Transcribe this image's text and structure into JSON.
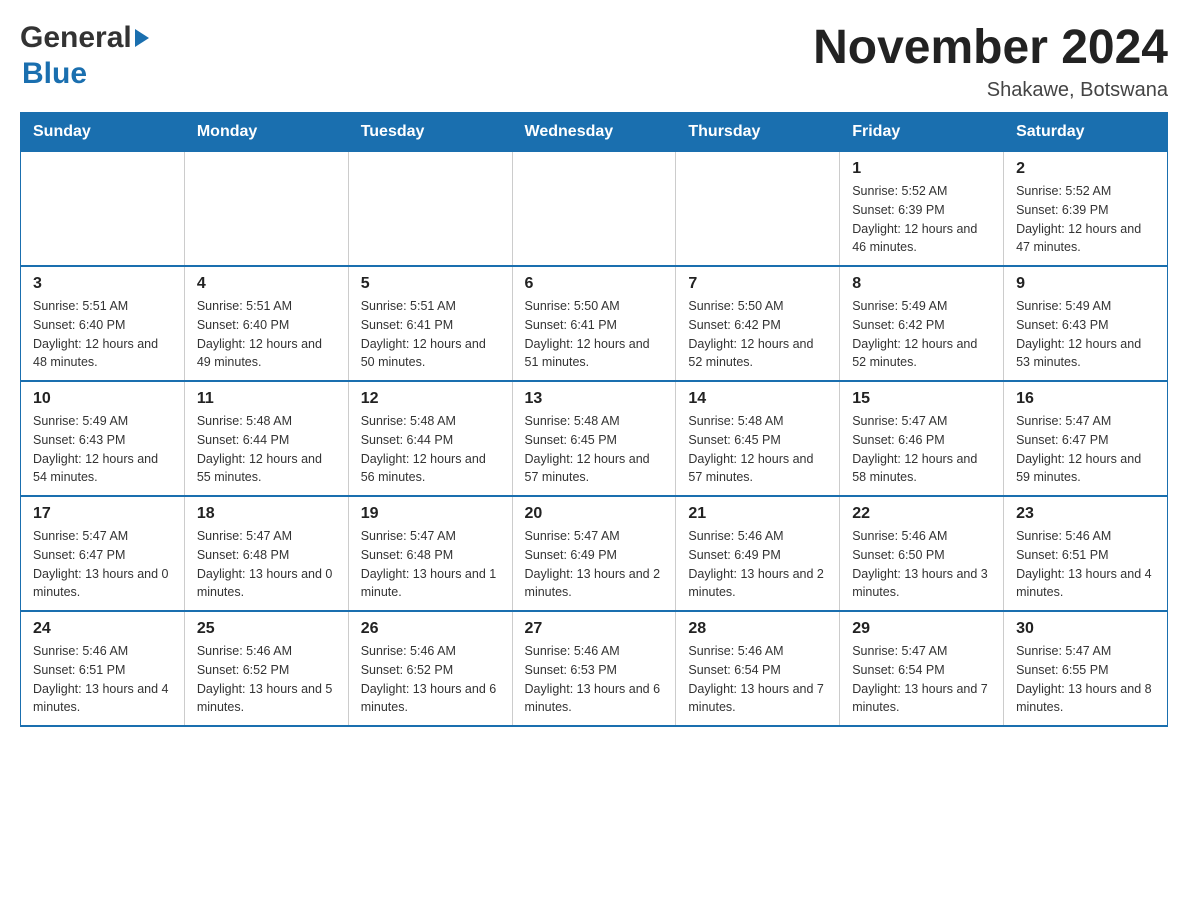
{
  "logo": {
    "general": "General",
    "blue": "Blue",
    "arrow": "▶"
  },
  "title": "November 2024",
  "subtitle": "Shakawe, Botswana",
  "days_header": [
    "Sunday",
    "Monday",
    "Tuesday",
    "Wednesday",
    "Thursday",
    "Friday",
    "Saturday"
  ],
  "weeks": [
    [
      {
        "day": "",
        "info": ""
      },
      {
        "day": "",
        "info": ""
      },
      {
        "day": "",
        "info": ""
      },
      {
        "day": "",
        "info": ""
      },
      {
        "day": "",
        "info": ""
      },
      {
        "day": "1",
        "info": "Sunrise: 5:52 AM\nSunset: 6:39 PM\nDaylight: 12 hours and 46 minutes."
      },
      {
        "day": "2",
        "info": "Sunrise: 5:52 AM\nSunset: 6:39 PM\nDaylight: 12 hours and 47 minutes."
      }
    ],
    [
      {
        "day": "3",
        "info": "Sunrise: 5:51 AM\nSunset: 6:40 PM\nDaylight: 12 hours and 48 minutes."
      },
      {
        "day": "4",
        "info": "Sunrise: 5:51 AM\nSunset: 6:40 PM\nDaylight: 12 hours and 49 minutes."
      },
      {
        "day": "5",
        "info": "Sunrise: 5:51 AM\nSunset: 6:41 PM\nDaylight: 12 hours and 50 minutes."
      },
      {
        "day": "6",
        "info": "Sunrise: 5:50 AM\nSunset: 6:41 PM\nDaylight: 12 hours and 51 minutes."
      },
      {
        "day": "7",
        "info": "Sunrise: 5:50 AM\nSunset: 6:42 PM\nDaylight: 12 hours and 52 minutes."
      },
      {
        "day": "8",
        "info": "Sunrise: 5:49 AM\nSunset: 6:42 PM\nDaylight: 12 hours and 52 minutes."
      },
      {
        "day": "9",
        "info": "Sunrise: 5:49 AM\nSunset: 6:43 PM\nDaylight: 12 hours and 53 minutes."
      }
    ],
    [
      {
        "day": "10",
        "info": "Sunrise: 5:49 AM\nSunset: 6:43 PM\nDaylight: 12 hours and 54 minutes."
      },
      {
        "day": "11",
        "info": "Sunrise: 5:48 AM\nSunset: 6:44 PM\nDaylight: 12 hours and 55 minutes."
      },
      {
        "day": "12",
        "info": "Sunrise: 5:48 AM\nSunset: 6:44 PM\nDaylight: 12 hours and 56 minutes."
      },
      {
        "day": "13",
        "info": "Sunrise: 5:48 AM\nSunset: 6:45 PM\nDaylight: 12 hours and 57 minutes."
      },
      {
        "day": "14",
        "info": "Sunrise: 5:48 AM\nSunset: 6:45 PM\nDaylight: 12 hours and 57 minutes."
      },
      {
        "day": "15",
        "info": "Sunrise: 5:47 AM\nSunset: 6:46 PM\nDaylight: 12 hours and 58 minutes."
      },
      {
        "day": "16",
        "info": "Sunrise: 5:47 AM\nSunset: 6:47 PM\nDaylight: 12 hours and 59 minutes."
      }
    ],
    [
      {
        "day": "17",
        "info": "Sunrise: 5:47 AM\nSunset: 6:47 PM\nDaylight: 13 hours and 0 minutes."
      },
      {
        "day": "18",
        "info": "Sunrise: 5:47 AM\nSunset: 6:48 PM\nDaylight: 13 hours and 0 minutes."
      },
      {
        "day": "19",
        "info": "Sunrise: 5:47 AM\nSunset: 6:48 PM\nDaylight: 13 hours and 1 minute."
      },
      {
        "day": "20",
        "info": "Sunrise: 5:47 AM\nSunset: 6:49 PM\nDaylight: 13 hours and 2 minutes."
      },
      {
        "day": "21",
        "info": "Sunrise: 5:46 AM\nSunset: 6:49 PM\nDaylight: 13 hours and 2 minutes."
      },
      {
        "day": "22",
        "info": "Sunrise: 5:46 AM\nSunset: 6:50 PM\nDaylight: 13 hours and 3 minutes."
      },
      {
        "day": "23",
        "info": "Sunrise: 5:46 AM\nSunset: 6:51 PM\nDaylight: 13 hours and 4 minutes."
      }
    ],
    [
      {
        "day": "24",
        "info": "Sunrise: 5:46 AM\nSunset: 6:51 PM\nDaylight: 13 hours and 4 minutes."
      },
      {
        "day": "25",
        "info": "Sunrise: 5:46 AM\nSunset: 6:52 PM\nDaylight: 13 hours and 5 minutes."
      },
      {
        "day": "26",
        "info": "Sunrise: 5:46 AM\nSunset: 6:52 PM\nDaylight: 13 hours and 6 minutes."
      },
      {
        "day": "27",
        "info": "Sunrise: 5:46 AM\nSunset: 6:53 PM\nDaylight: 13 hours and 6 minutes."
      },
      {
        "day": "28",
        "info": "Sunrise: 5:46 AM\nSunset: 6:54 PM\nDaylight: 13 hours and 7 minutes."
      },
      {
        "day": "29",
        "info": "Sunrise: 5:47 AM\nSunset: 6:54 PM\nDaylight: 13 hours and 7 minutes."
      },
      {
        "day": "30",
        "info": "Sunrise: 5:47 AM\nSunset: 6:55 PM\nDaylight: 13 hours and 8 minutes."
      }
    ]
  ]
}
